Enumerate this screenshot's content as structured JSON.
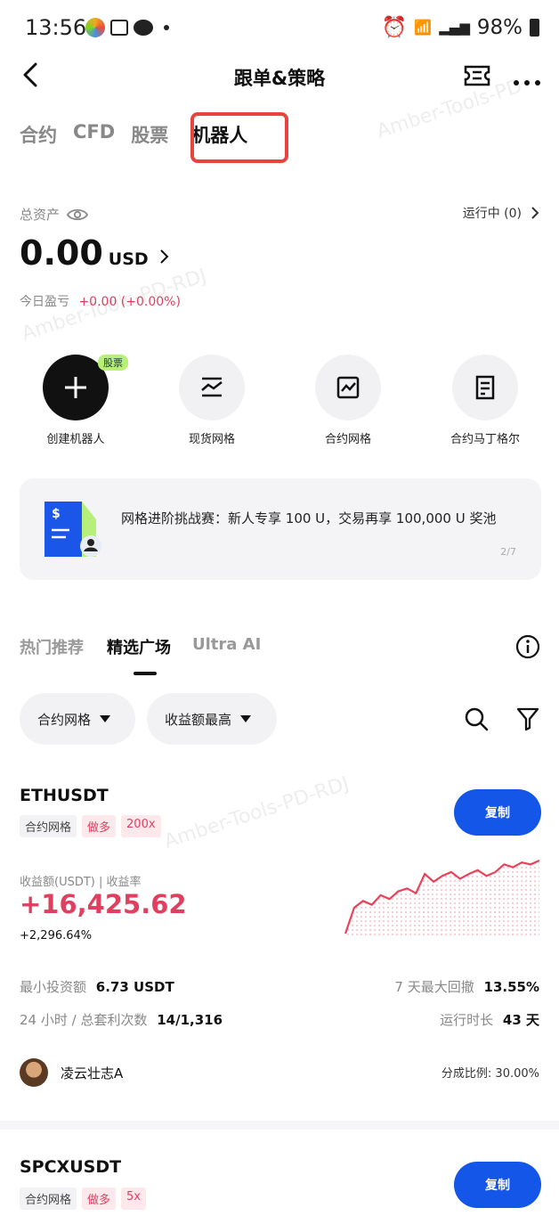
{
  "status_bar": {
    "time": "13:56",
    "battery": "98%"
  },
  "header": {
    "title": "跟单&策略"
  },
  "tabs": [
    {
      "label": "合约"
    },
    {
      "label": "CFD"
    },
    {
      "label": "股票"
    },
    {
      "label": "机器人"
    }
  ],
  "assets": {
    "label": "总资产",
    "running": "运行中 (0)",
    "amount": "0.00",
    "currency": "USD",
    "today_label": "今日盈亏",
    "today_value": "+0.00 (+0.00%)"
  },
  "features": [
    {
      "label": "创建机器人",
      "badge": "股票",
      "icon": "plus-icon"
    },
    {
      "label": "现货网格",
      "icon": "spot-grid-icon"
    },
    {
      "label": "合约网格",
      "icon": "futures-grid-icon"
    },
    {
      "label": "合约马丁格尔",
      "icon": "martingale-icon"
    }
  ],
  "banner": {
    "text": "网格进阶挑战赛：新人专享 100 U，交易再享 100,000 U 奖池",
    "pager": "2/7"
  },
  "sub_tabs": [
    {
      "label": "热门推荐"
    },
    {
      "label": "精选广场"
    },
    {
      "label": "Ultra AI"
    }
  ],
  "filters": [
    {
      "label": "合约网格"
    },
    {
      "label": "收益额最高"
    }
  ],
  "strategies": [
    {
      "symbol": "ETHUSDT",
      "tags": [
        "合约网格",
        "做多",
        "200x"
      ],
      "copy_label": "复制",
      "profit_label": "收益额(USDT) | 收益率",
      "profit": "+16,425.62",
      "profit_rate": "+2,296.64%",
      "min_invest_label": "最小投资额",
      "min_invest": "6.73 USDT",
      "drawdown_label": "7 天最大回撤",
      "drawdown": "13.55%",
      "arb_label": "24 小时 / 总套利次数",
      "arb": "14/1,316",
      "runtime_label": "运行时长",
      "runtime": "43 天",
      "author": "凌云壮志A",
      "share": "分成比例: 30.00%"
    },
    {
      "symbol": "SPCXUSDT",
      "tags": [
        "合约网格",
        "做多",
        "5x"
      ],
      "copy_label": "复制"
    }
  ],
  "chart_data": {
    "type": "area",
    "color": "#e8435a",
    "values": [
      8,
      35,
      42,
      38,
      48,
      44,
      52,
      55,
      50,
      70,
      62,
      68,
      72,
      65,
      70,
      74,
      68,
      72,
      80,
      77,
      82,
      80,
      84
    ]
  }
}
